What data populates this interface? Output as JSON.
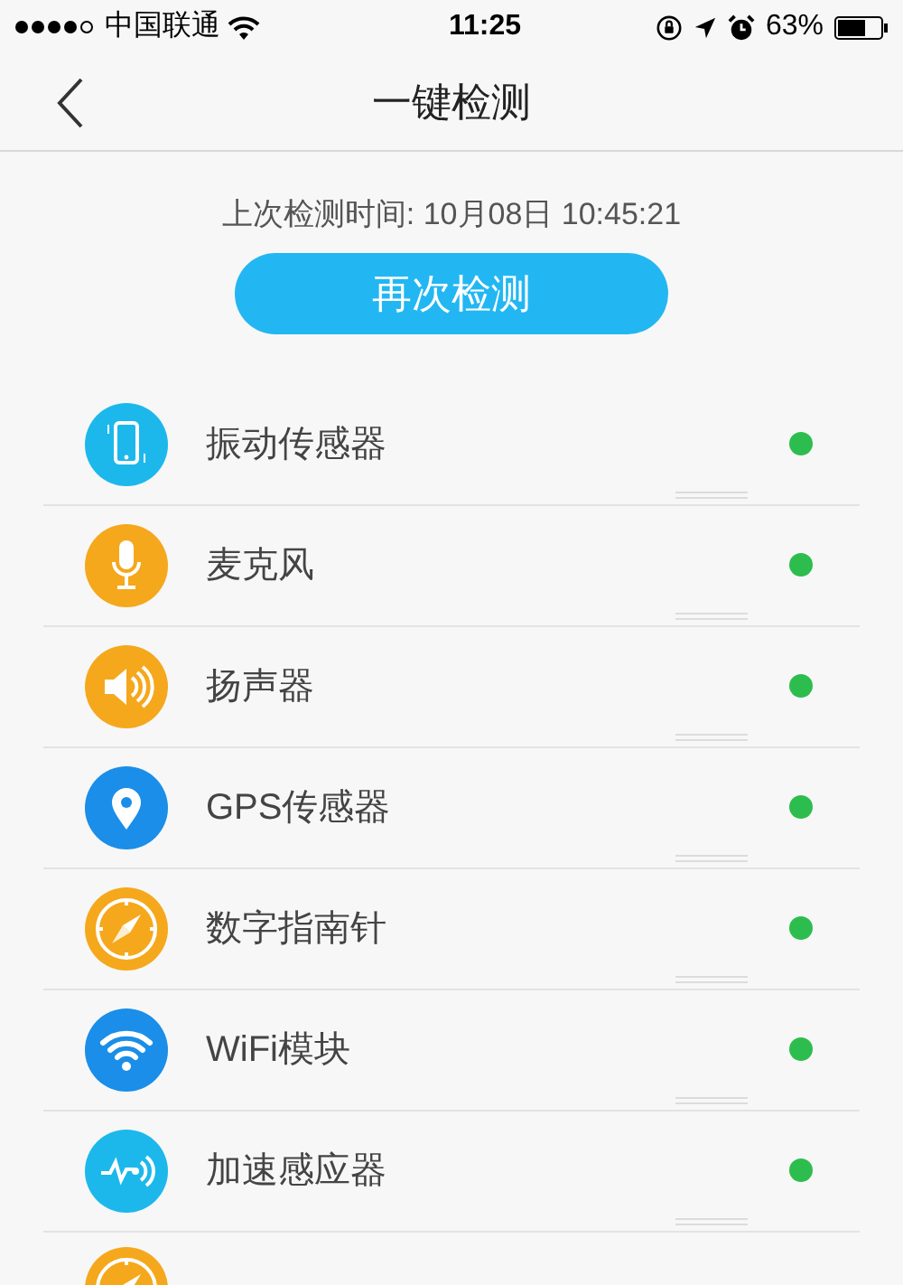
{
  "status_bar": {
    "carrier": "中国联通",
    "time": "11:25",
    "battery": "63%"
  },
  "nav": {
    "title": "一键检测"
  },
  "last_check": "上次检测时间: 10月08日 10:45:21",
  "recheck_button": "再次检测",
  "items": [
    {
      "kind": "sensor",
      "label": "振动传感器",
      "color": "#2dbd4e"
    },
    {
      "kind": "sensor",
      "label": "麦克风",
      "color": "#2dbd4e"
    },
    {
      "kind": "sensor",
      "label": "扬声器",
      "color": "#2dbd4e"
    },
    {
      "kind": "sensor",
      "label": "GPS传感器",
      "color": "#2dbd4e"
    },
    {
      "kind": "sensor",
      "label": "数字指南针",
      "color": "#2dbd4e"
    },
    {
      "kind": "sensor",
      "label": "WiFi模块",
      "color": "#2dbd4e"
    },
    {
      "kind": "sensor",
      "label": "加速感应器",
      "color": "#2dbd4e"
    },
    {
      "kind": "cut"
    }
  ]
}
